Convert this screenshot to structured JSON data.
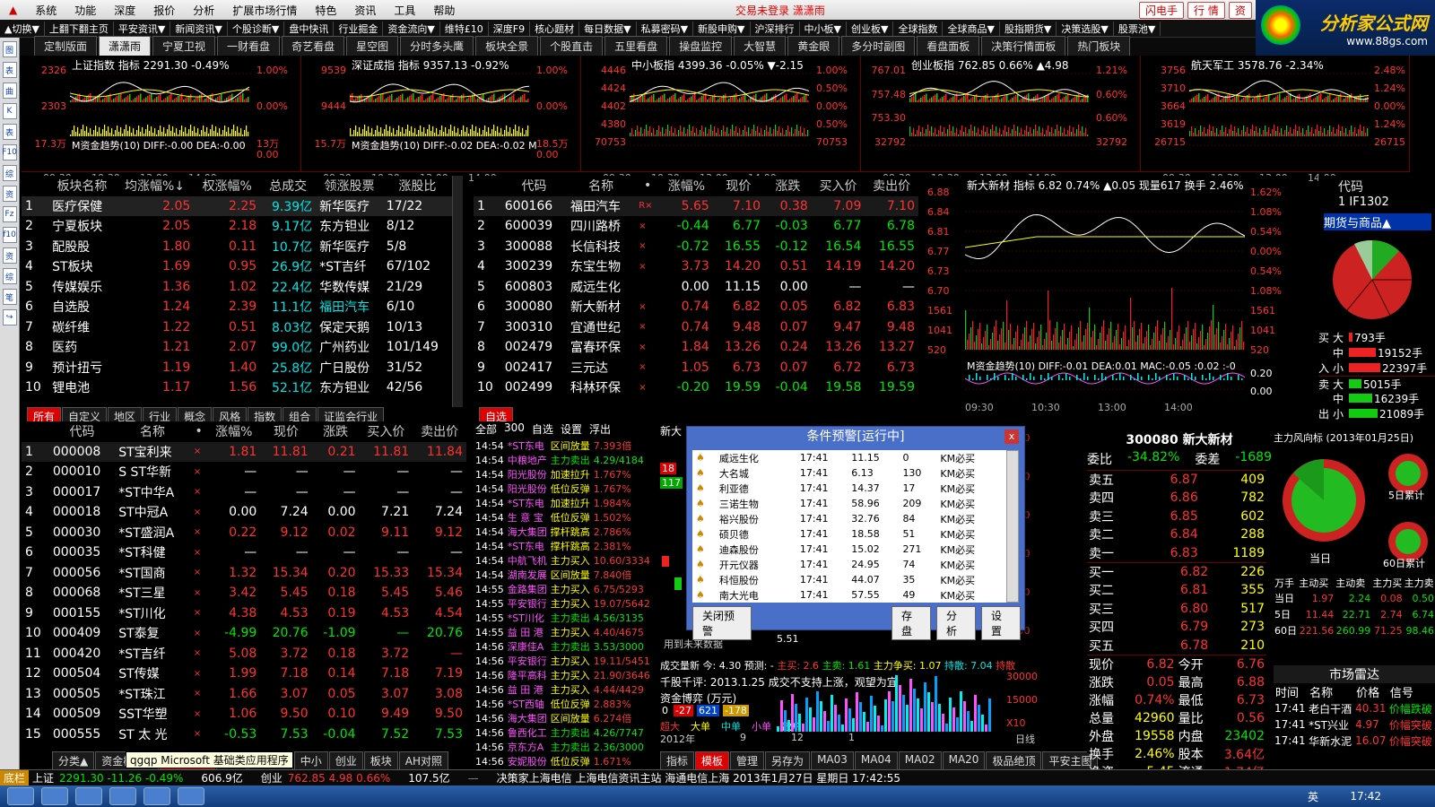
{
  "menu": [
    "系统",
    "功能",
    "深度",
    "报价",
    "分析",
    "扩展市场行情",
    "特色",
    "资讯",
    "工具",
    "帮助"
  ],
  "menu_status": "交易未登录   潇潇雨",
  "menu_buttons": [
    "闪电手",
    "行 情",
    "资"
  ],
  "logo": {
    "line1": "分析家公式网",
    "line2": "www.88gs.com"
  },
  "toolbar": [
    "▲切换▼",
    "上翻下翻主页",
    "平安资讯▼",
    "新闻资讯▼",
    "个股诊断▼",
    "盘中快讯",
    "行业掘金",
    "资金流向▼",
    "维特£10",
    "深度F9",
    "核心题材",
    "每日数据▼",
    "私募密码▼",
    "新股申购▼",
    "沪深排行",
    "中小板▼",
    "创业板▼",
    "全球指数",
    "全球商品▼",
    "股指期货▼",
    "决策选股▼",
    "股票池▼"
  ],
  "tabs": [
    "定制版面",
    "潇潇雨",
    "宁夏卫视",
    "一财看盘",
    "奇艺看盘",
    "星空图",
    "分时多头鹰",
    "板块全景",
    "个股直击",
    "五里看盘",
    "操盘监控",
    "大智慧",
    "黄金眼",
    "多分时副图",
    "看盘面板",
    "决策行情面板",
    "热门板块"
  ],
  "left_icons": [
    "图",
    "表",
    "曲",
    "K",
    "表",
    "F10",
    "综",
    "资",
    "Fz",
    "f10",
    "资",
    "综",
    "笔",
    "↪"
  ],
  "mini_charts": [
    {
      "name": "上证指数",
      "info": "指标 2291.30 -0.49%",
      "yl": [
        "2326",
        "2303",
        "17.3万"
      ],
      "yr": [
        "1.00%",
        "0.00%",
        "13万"
      ],
      "macd": "M资金趋势(10) DIFF:-0.00 DEA:-0.00",
      "bottom": "0.00",
      "times": [
        "09:30",
        "10:30",
        "13:00",
        "14:00"
      ]
    },
    {
      "name": "深证成指",
      "info": "指标 9357.13 -0.92%",
      "yl": [
        "9539",
        "9444",
        "15.7万"
      ],
      "yr": [
        "1.00%",
        "0.00%",
        "18.5万"
      ],
      "macd": "M资金趋势(10) DIFF:-0.02 DEA:-0.02 M",
      "bottom": "0.00",
      "times": [
        "09:30",
        "10:30",
        "13:00",
        "14:00"
      ]
    },
    {
      "name": "中小板指",
      "info": "4399.36 -0.05% ▼-2.15",
      "yl": [
        "4446",
        "4424",
        "4402",
        "4380",
        "70753"
      ],
      "yr": [
        "1.00%",
        "0.50%",
        "0.00%",
        "0.50%",
        "70753"
      ],
      "macd": "",
      "bottom": "",
      "times": [
        "09:30",
        "10:30",
        "13:00",
        "14:00"
      ]
    },
    {
      "name": "创业板指",
      "info": "762.85 0.66% ▲4.98",
      "yl": [
        "767.01",
        "757.48",
        "753.30",
        "32792"
      ],
      "yr": [
        "1.21%",
        "0.60%",
        "0.60%",
        "32792"
      ],
      "macd": "",
      "bottom": "",
      "times": [
        "09:30",
        "10:30",
        "13:00",
        "14:00"
      ]
    },
    {
      "name": "航天军工",
      "info": "3578.76 -2.34%",
      "yl": [
        "3756",
        "3710",
        "3664",
        "3619",
        "26715"
      ],
      "yr": [
        "2.48%",
        "1.24%",
        "0.00%",
        "1.24%",
        "26715"
      ],
      "macd": "",
      "bottom": "",
      "times": [
        "09:30",
        "10:30",
        "13:00",
        "14:00"
      ]
    }
  ],
  "sector_table": {
    "headers": [
      "板块名称",
      "均涨幅%↓",
      "权涨幅%",
      "总成交",
      "领涨股票",
      "涨股比"
    ],
    "rows": [
      [
        "1",
        "医疗保健",
        "2.05",
        "2.25",
        "9.39亿",
        "新华医疗",
        "17/22"
      ],
      [
        "2",
        "宁夏板块",
        "2.05",
        "2.18",
        "9.17亿",
        "东方钽业",
        "8/12"
      ],
      [
        "3",
        "配股股",
        "1.80",
        "0.11",
        "10.7亿",
        "新华医疗",
        "5/8"
      ],
      [
        "4",
        "ST板块",
        "1.69",
        "0.95",
        "26.9亿",
        "*ST吉纤",
        "67/102"
      ],
      [
        "5",
        "传媒娱乐",
        "1.36",
        "1.02",
        "22.4亿",
        "华数传媒",
        "21/29"
      ],
      [
        "6",
        "自选股",
        "1.24",
        "2.39",
        "11.1亿",
        "福田汽车",
        "6/10"
      ],
      [
        "7",
        "碳纤维",
        "1.22",
        "0.51",
        "8.03亿",
        "保定天鹅",
        "10/13"
      ],
      [
        "8",
        "医药",
        "1.21",
        "2.07",
        "99.0亿",
        "广州药业",
        "101/149"
      ],
      [
        "9",
        "预计扭亏",
        "1.19",
        "1.40",
        "25.8亿",
        "广日股份",
        "31/52"
      ],
      [
        "10",
        "锂电池",
        "1.17",
        "1.56",
        "52.1亿",
        "东方钽业",
        "42/56"
      ]
    ]
  },
  "self_table": {
    "headers": [
      "代码",
      "名称",
      "•",
      "涨幅%",
      "现价",
      "涨跌",
      "买入价",
      "卖出价"
    ],
    "rows": [
      [
        "1",
        "600166",
        "福田汽车",
        "R×",
        "5.65",
        "7.10",
        "0.38",
        "7.09",
        "7.10"
      ],
      [
        "2",
        "600039",
        "四川路桥",
        "×",
        "-0.44",
        "6.77",
        "-0.03",
        "6.77",
        "6.78"
      ],
      [
        "3",
        "300088",
        "长信科技",
        "×",
        "-0.72",
        "16.55",
        "-0.12",
        "16.54",
        "16.55"
      ],
      [
        "4",
        "300239",
        "东宝生物",
        "×",
        "3.73",
        "14.20",
        "0.51",
        "14.19",
        "14.20"
      ],
      [
        "5",
        "600803",
        "威远生化",
        "",
        "0.00",
        "11.15",
        "0.00",
        "—",
        "—"
      ],
      [
        "6",
        "300080",
        "新大新材",
        "×",
        "0.74",
        "6.82",
        "0.05",
        "6.82",
        "6.83"
      ],
      [
        "7",
        "300310",
        "宜通世纪",
        "×",
        "0.74",
        "9.48",
        "0.07",
        "9.47",
        "9.48"
      ],
      [
        "8",
        "002479",
        "富春环保",
        "×",
        "1.84",
        "13.26",
        "0.24",
        "13.26",
        "13.27"
      ],
      [
        "9",
        "002417",
        "三元达",
        "×",
        "1.05",
        "6.73",
        "0.07",
        "6.72",
        "6.73"
      ],
      [
        "10",
        "002499",
        "科林环保",
        "×",
        "-0.20",
        "19.59",
        "-0.04",
        "19.58",
        "19.59"
      ]
    ]
  },
  "stock_chart": {
    "name": "新大新材",
    "info": "指标 6.82 0.74% ▲0.05 现量617 换手 2.46%",
    "yl": [
      "6.88",
      "6.84",
      "6.81",
      "6.77",
      "6.73",
      "6.70",
      "1561",
      "1041",
      "520"
    ],
    "yr": [
      "1.62%",
      "1.08%",
      "0.54%",
      "0.00%",
      "0.54%",
      "1.08%",
      "1561",
      "1041",
      "520"
    ],
    "macd": "M资金趋势(10) DIFF:-0.01 DEA:0.01 MAC:-0.05 :0.02 :-0",
    "macd_r": [
      "0.20",
      "0.00"
    ],
    "times": [
      "09:30",
      "10:30",
      "13:00",
      "14:00"
    ]
  },
  "futures": {
    "hdr": "代码",
    "code": "1  IF1302",
    "cat": "期货与商品▲",
    "buy_lbl": [
      "买",
      "入"
    ],
    "sell_lbl": [
      "卖",
      "出"
    ],
    "rows": [
      [
        "大",
        "793手"
      ],
      [
        "中",
        "19152手"
      ],
      [
        "小",
        "22397手"
      ],
      [
        "大",
        "5015手"
      ],
      [
        "中",
        "16239手"
      ],
      [
        "小",
        "21089手"
      ]
    ]
  },
  "st_table": {
    "headers": [
      "代码",
      "名称",
      "•",
      "涨幅%",
      "现价",
      "涨跌",
      "买入价",
      "卖出价"
    ],
    "rows": [
      [
        "1",
        "000008",
        "ST宝利来",
        "×",
        "1.81",
        "11.81",
        "0.21",
        "11.81",
        "11.84"
      ],
      [
        "2",
        "000010",
        "S ST华新",
        "×",
        "—",
        "—",
        "—",
        "—",
        "—"
      ],
      [
        "3",
        "000017",
        "*ST中华A",
        "×",
        "—",
        "—",
        "—",
        "—",
        "—"
      ],
      [
        "4",
        "000018",
        "ST中冠A",
        "×",
        "0.00",
        "7.24",
        "0.00",
        "7.21",
        "7.24"
      ],
      [
        "5",
        "000030",
        "*ST盛润A",
        "×",
        "0.22",
        "9.12",
        "0.02",
        "9.11",
        "9.12"
      ],
      [
        "6",
        "000035",
        "*ST科健",
        "×",
        "—",
        "—",
        "—",
        "—",
        "—"
      ],
      [
        "7",
        "000056",
        "*ST国商",
        "×",
        "1.32",
        "15.34",
        "0.20",
        "15.33",
        "15.34"
      ],
      [
        "8",
        "000068",
        "*ST三星",
        "×",
        "3.42",
        "5.45",
        "0.18",
        "5.45",
        "5.46"
      ],
      [
        "9",
        "000155",
        "*ST川化",
        "×",
        "4.38",
        "4.53",
        "0.19",
        "4.53",
        "4.54"
      ],
      [
        "10",
        "000409",
        "ST泰复",
        "×",
        "-4.99",
        "20.76",
        "-1.09",
        "—",
        "20.76"
      ],
      [
        "11",
        "000420",
        "*ST吉纤",
        "×",
        "5.08",
        "3.72",
        "0.18",
        "3.72",
        "—"
      ],
      [
        "12",
        "000504",
        "ST传媒",
        "×",
        "1.99",
        "7.18",
        "0.14",
        "7.18",
        "7.19"
      ],
      [
        "13",
        "000505",
        "*ST珠江",
        "×",
        "1.66",
        "3.07",
        "0.05",
        "3.07",
        "3.08"
      ],
      [
        "14",
        "000509",
        "SST华塑",
        "×",
        "1.06",
        "9.50",
        "0.10",
        "9.49",
        "9.50"
      ],
      [
        "15",
        "000555",
        "ST 太 光",
        "×",
        "-0.53",
        "7.53",
        "-0.04",
        "7.52",
        "7.53"
      ]
    ]
  },
  "bottom_tabs_left": [
    "所有",
    "自定义",
    "地区",
    "行业",
    "概念",
    "风格",
    "指数",
    "组合",
    "证监会行业"
  ],
  "bottom_tabs_left2": [
    "分类▲",
    "资金模型▲",
    "决策信号",
    "A股",
    "自定义",
    "中小",
    "创业",
    "板块",
    "AH对照"
  ],
  "feed": {
    "hdr": [
      "全部",
      "300",
      "自选",
      "设置",
      "浮出"
    ],
    "tab": "自选",
    "rows": [
      [
        "14:54",
        "*ST东电",
        "区间放量",
        "7.393倍"
      ],
      [
        "14:54",
        "中粮地产",
        "主力卖出",
        "4.29/4184"
      ],
      [
        "14:54",
        "阳光股份",
        "加速拉升",
        "1.767%"
      ],
      [
        "14:54",
        "阳光股份",
        "低位反弹",
        "1.767%"
      ],
      [
        "14:54",
        "*ST东电",
        "加速拉升",
        "1.984%"
      ],
      [
        "14:54",
        "生 意 宝",
        "低位反弹",
        "1.502%"
      ],
      [
        "14:54",
        "海大集团",
        "撑杆跳高",
        "2.786%"
      ],
      [
        "14:54",
        "*ST东电",
        "撑杆跳高",
        "2.381%"
      ],
      [
        "14:54",
        "中航飞机",
        "主力买入",
        "10.60/3334"
      ],
      [
        "14:54",
        "湖南发展",
        "区间放量",
        "7.840倍"
      ],
      [
        "14:55",
        "金路集团",
        "主力买入",
        "6.75/5293"
      ],
      [
        "14:55",
        "平安银行",
        "主力买入",
        "19.07/5642"
      ],
      [
        "14:55",
        "*ST川化",
        "主力卖出",
        "4.56/3135"
      ],
      [
        "14:55",
        "益 田 港",
        "主力买入",
        "4.40/4675"
      ],
      [
        "14:56",
        "深康佳A",
        "主力卖出",
        "3.53/3000"
      ],
      [
        "14:56",
        "平安银行",
        "主力买入",
        "19.11/5451"
      ],
      [
        "14:56",
        "隆平高科",
        "主力买入",
        "21.90/3646"
      ],
      [
        "14:56",
        "益 田 港",
        "主力买入",
        "4.44/4429"
      ],
      [
        "14:56",
        "*ST西轴",
        "低位反弹",
        "2.883%"
      ],
      [
        "14:56",
        "海大集团",
        "区间放量",
        "6.274倍"
      ],
      [
        "14:56",
        "鲁西化工",
        "主力卖出",
        "4.26/7747"
      ],
      [
        "14:56",
        "京东方A",
        "主力卖出",
        "2.36/3000"
      ],
      [
        "14:56",
        "安妮股份",
        "低位反弹",
        "1.671%"
      ]
    ]
  },
  "mid_chart": {
    "name": "新大",
    "labels": [
      "18",
      "117"
    ],
    "yr": [
      "8.00",
      "7.50",
      "7.00",
      "6.50",
      "6.00",
      "5.50"
    ],
    "low": "5.51",
    "note": "用到未来数据"
  },
  "mid_lower": {
    "line1_lbl": "成交量新 今: 4.30 预测: -",
    "line1_a": "主买: 2.6",
    "line1_b": "主卖: 1.61",
    "line1_c": "主力争买: 1.07",
    "line1_d": "持散: 7.04",
    "line1_e": "持散",
    "line2": "千股千评: 2013.1.25 成交不支持上涨，观望为宜",
    "line3": "资金博弈 (万元)",
    "vals": [
      "0",
      "-27",
      "621",
      "-178"
    ],
    "legend": [
      "超大",
      "大单",
      "中单",
      "小单",
      "散户"
    ],
    "yr": [
      "30000",
      "15000",
      "X10"
    ],
    "month": [
      "2012年",
      "9",
      "12",
      "1"
    ],
    "kline": "日线"
  },
  "mid_tabs": [
    "指标",
    "模板",
    "管理",
    "另存为",
    "MA03",
    "MA04",
    "MA02",
    "MA20",
    "极品绝顶",
    "平安主图"
  ],
  "quote": {
    "title": "300080 新大新材",
    "wb_lbl": "委比",
    "wb": "-34.82%",
    "wc_lbl": "委差",
    "wc": "-1689",
    "sell": [
      [
        "卖五",
        "6.87",
        "409"
      ],
      [
        "卖四",
        "6.86",
        "782"
      ],
      [
        "卖三",
        "6.85",
        "602"
      ],
      [
        "卖二",
        "6.84",
        "288"
      ],
      [
        "卖一",
        "6.83",
        "1189"
      ]
    ],
    "buy": [
      [
        "买一",
        "6.82",
        "226"
      ],
      [
        "买二",
        "6.81",
        "355"
      ],
      [
        "买三",
        "6.80",
        "517"
      ],
      [
        "买四",
        "6.79",
        "273"
      ],
      [
        "买五",
        "6.78",
        "210"
      ]
    ],
    "stats": [
      [
        "现价",
        "6.82",
        "今开",
        "6.76"
      ],
      [
        "涨跌",
        "0.05",
        "最高",
        "6.88"
      ],
      [
        "涨幅",
        "0.74%",
        "最低",
        "6.73"
      ],
      [
        "总量",
        "42960",
        "量比",
        "0.56"
      ],
      [
        "外盘",
        "19558",
        "内盘",
        "23402"
      ],
      [
        "换手",
        "2.46%",
        "股本",
        "3.64亿"
      ],
      [
        "净资",
        "5.45",
        "流通",
        "1.74亿"
      ]
    ]
  },
  "flow": {
    "title": "主力风向标 (2013年01月25日)",
    "today": "当日",
    "d5": "5日累计",
    "d60": "60日累计",
    "tbl_hdr": [
      "万手",
      "主动买",
      "主动卖",
      "主力买",
      "主力卖"
    ],
    "tbl": [
      [
        "当日",
        "1.97",
        "2.24",
        "0.08",
        "0.50"
      ],
      [
        "5日",
        "11.44",
        "22.71",
        "2.74",
        "6.74"
      ],
      [
        "60日",
        "221.56",
        "260.99",
        "71.25",
        "98.46"
      ]
    ]
  },
  "radar": {
    "title": "市场雷达",
    "hdr": [
      "时间",
      "名称",
      "价格",
      "信号"
    ],
    "rows": [
      [
        "17:41",
        "老白干酒",
        "40.31",
        "价幅跌破"
      ],
      [
        "17:41",
        "*ST兴业",
        "4.97",
        "价幅突破"
      ],
      [
        "17:41",
        "华新水泥",
        "16.07",
        "价幅突破"
      ]
    ]
  },
  "dialog": {
    "title": "条件预警[运行中]",
    "close": "x",
    "rows": [
      [
        "威远生化",
        "17:41",
        "11.15",
        "0",
        "KM必买"
      ],
      [
        "大名城",
        "17:41",
        "6.13",
        "130",
        "KM必买"
      ],
      [
        "利亚德",
        "17:41",
        "14.37",
        "17",
        "KM必买"
      ],
      [
        "三诺生物",
        "17:41",
        "58.96",
        "209",
        "KM必买"
      ],
      [
        "裕兴股份",
        "17:41",
        "32.76",
        "84",
        "KM必买"
      ],
      [
        "硕贝德",
        "17:41",
        "18.58",
        "51",
        "KM必买"
      ],
      [
        "迪森股份",
        "17:41",
        "15.02",
        "271",
        "KM必买"
      ],
      [
        "开元仪器",
        "17:41",
        "24.95",
        "74",
        "KM必买"
      ],
      [
        "科恒股份",
        "17:41",
        "44.07",
        "35",
        "KM必买"
      ],
      [
        "南大光电",
        "17:41",
        "57.55",
        "49",
        "KM必买"
      ]
    ],
    "buttons": [
      "关闭预警",
      "存盘",
      "分析",
      "设置"
    ]
  },
  "status": {
    "lbl": "底栏",
    "sh": "上证",
    "sh_val": "2291.30 -11.26 -0.49%",
    "vol1": "606.9亿",
    "cy": "创业",
    "cy_val": "762.85  4.98  0.66%",
    "vol2": "107.5亿",
    "marquee": "决策家上海电信  上海电信资讯主站  海通电信上海  2013年1月27日  星期日  17:42:55",
    "tooltip": "qgqp Microsoft 基础类应用程序",
    "dash": "—"
  },
  "taskbar": {
    "clock": "17:42",
    "ime": "英"
  },
  "colors": {
    "up": "#ff3232",
    "down": "#00e600",
    "border": "#6b0000",
    "dialog": "#4a6fc8"
  }
}
